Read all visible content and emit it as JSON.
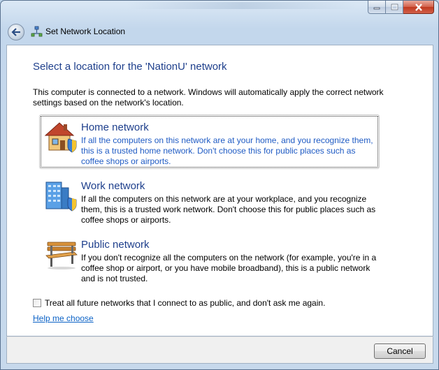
{
  "window": {
    "title": "Set Network Location",
    "controls": {
      "minimize": "minimize",
      "maximize": "maximize",
      "close": "close"
    }
  },
  "heading": "Select a location for the 'NationU' network",
  "intro": "This computer is connected to a network. Windows will automatically apply the correct network settings based on the network's location.",
  "options": [
    {
      "title": "Home network",
      "icon": "house-icon",
      "selected": true,
      "description": "If all the computers on this network are at your home, and you recognize them, this is a trusted home network.  Don't choose this for public places such as coffee shops or airports."
    },
    {
      "title": "Work network",
      "icon": "office-building-icon",
      "selected": false,
      "description": "If all the computers on this network are at your workplace, and you recognize them, this is a trusted work network.  Don't choose this for public places such as coffee shops or airports."
    },
    {
      "title": "Public network",
      "icon": "park-bench-icon",
      "selected": false,
      "description": "If you don't recognize all the computers on the network (for example, you're in a coffee shop or airport, or you have mobile broadband), this is a public network and is not trusted."
    }
  ],
  "checkbox": {
    "label": "Treat all future networks that I connect to as public, and don't ask me again.",
    "checked": false
  },
  "help_link": "Help me choose",
  "buttons": {
    "cancel": "Cancel"
  },
  "colors": {
    "heading": "#1e3f8c",
    "link": "#0b62c6",
    "selected_text": "#1f5bc4"
  }
}
